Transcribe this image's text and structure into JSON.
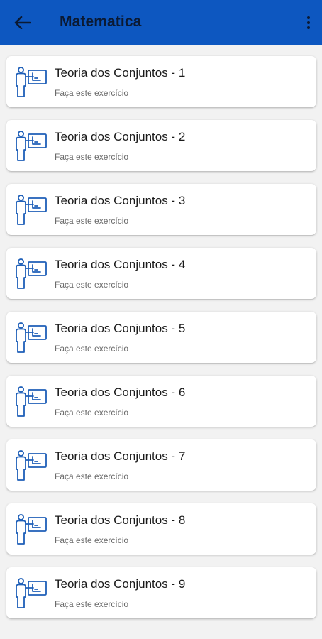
{
  "app_bar": {
    "title": "Matematica",
    "back_icon": "arrow-left-icon",
    "menu_icon": "more-vertical-icon",
    "background_color": "#0d57c0"
  },
  "exercises": [
    {
      "title": "Teoria dos Conjuntos - 1",
      "subtitle": "Faça este exercício",
      "icon": "teacher-board-icon"
    },
    {
      "title": "Teoria dos Conjuntos - 2",
      "subtitle": "Faça este exercício",
      "icon": "teacher-board-icon"
    },
    {
      "title": "Teoria dos Conjuntos - 3",
      "subtitle": "Faça este exercício",
      "icon": "teacher-board-icon"
    },
    {
      "title": "Teoria dos Conjuntos - 4",
      "subtitle": "Faça este exercício",
      "icon": "teacher-board-icon"
    },
    {
      "title": "Teoria dos Conjuntos - 5",
      "subtitle": "Faça este exercício",
      "icon": "teacher-board-icon"
    },
    {
      "title": "Teoria dos Conjuntos - 6",
      "subtitle": "Faça este exercício",
      "icon": "teacher-board-icon"
    },
    {
      "title": "Teoria dos Conjuntos - 7",
      "subtitle": "Faça este exercício",
      "icon": "teacher-board-icon"
    },
    {
      "title": "Teoria dos Conjuntos - 8",
      "subtitle": "Faça este exercício",
      "icon": "teacher-board-icon"
    },
    {
      "title": "Teoria dos Conjuntos - 9",
      "subtitle": "Faça este exercício",
      "icon": "teacher-board-icon"
    }
  ],
  "icon_color": "#1e5fb8"
}
